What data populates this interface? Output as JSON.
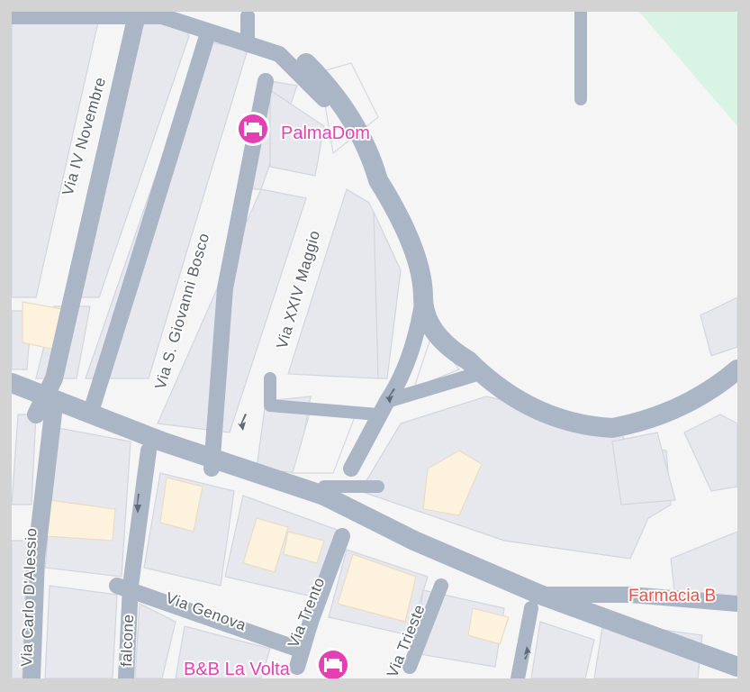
{
  "map": {
    "streets": {
      "via_iv_novembre": "Via IV Novembre",
      "via_s_giovanni_bosco": "Via S. Giovanni Bosco",
      "via_xxiv_maggio": "Via XXIV Maggio",
      "via_carlo_dalessio": "Via Carlo D'Alessio",
      "via_falcone": "falcone",
      "via_genova": "Via Genova",
      "via_trento": "Via Trento",
      "via_trieste": "Via Trieste"
    },
    "pois": {
      "palmadom": {
        "label": "PalmaDom",
        "icon": "hotel-bed-icon"
      },
      "bb_la_volta": {
        "label": "B&B La Volta",
        "icon": "hotel-bed-icon"
      },
      "farmacia": {
        "label": "Farmacia B"
      }
    },
    "colors": {
      "road": "#aab6c6",
      "block": "#e7e8ee",
      "highlight_block": "#fdf2de",
      "park": "#d9f4e4",
      "poi_hotel": "#e43fb3",
      "poi_pharmacy": "#e5534b"
    }
  }
}
